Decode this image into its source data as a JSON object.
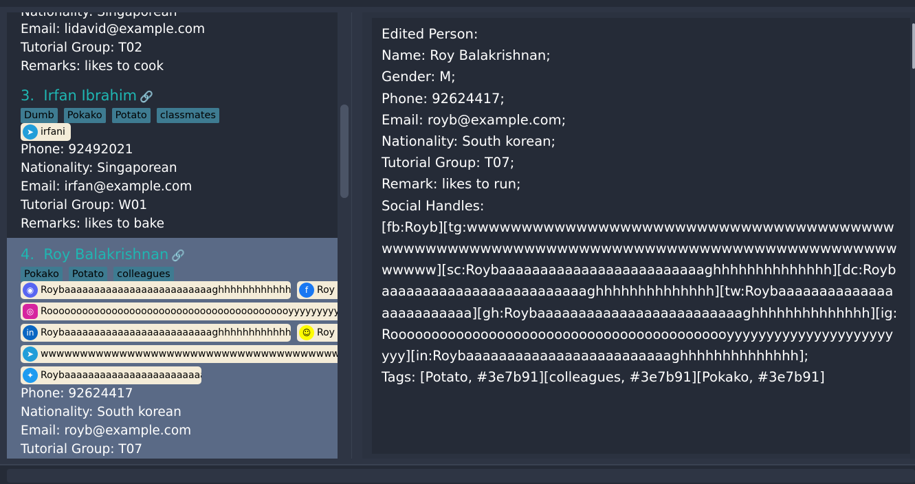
{
  "list": {
    "card2": {
      "nationality_partial": "Nationality: Singaporean",
      "email": "Email: lidavid@example.com",
      "tutorial": "Tutorial Group: T02",
      "remarks": "Remarks: likes to cook"
    },
    "card3": {
      "index": "3.",
      "name": "Irfan Ibrahim",
      "tags": [
        "Dumb",
        "Pokako",
        "Potato",
        "classmates"
      ],
      "telegram": "irfani",
      "phone": "Phone: 92492021",
      "nationality": "Nationality: Singaporean",
      "email": "Email: irfan@example.com",
      "tutorial": "Tutorial Group: W01",
      "remarks": "Remarks: likes to bake"
    },
    "card4": {
      "index": "4.",
      "name": "Roy Balakrishnan",
      "tags": [
        "Pokako",
        "Potato",
        "colleagues"
      ],
      "discord": "Roybaaaaaaaaaaaaaaaaaaaaaaaaaghhhhhhhhhhhhhh",
      "facebook": "Roy",
      "instagram": "Roooooooooooooooooooooooooooooooooooooooooyyyyyyyyyyyyyyyyyy",
      "linkedin": "Roybaaaaaaaaaaaaaaaaaaaaaaaaaghhhhhhhhhhhhhh",
      "snapchat": "Roy",
      "telegram": "wwwwwwwwwwwwwwwwwwwwwwwwwwwwwwwwwwwwwwwwwwwwwwwwwwwww",
      "twitter": "Roybaaaaaaaaaaaaaaaaaaaaaaaaa",
      "phone": "Phone: 92624417",
      "nationality": "Nationality: South korean",
      "email": "Email: royb@example.com",
      "tutorial": "Tutorial Group: T07"
    }
  },
  "result": {
    "lines": [
      "Edited Person:",
      "Name: Roy Balakrishnan;",
      "Gender: M;",
      "Phone: 92624417;",
      "Email: royb@example.com;",
      "Nationality: South korean;",
      "Tutorial Group: T07;",
      "Remark: likes to run;",
      "Social Handles:",
      "[fb:Royb][tg:wwwwwwwwwwwwwwwwwwwwwwwwwwwwwwwwwwwwwwwwwwwwwwwwwwwwwwwwwwwwwwwwwwwwwwwwwwwwwwwwwwwwwwwwwww][sc:Roybaaaaaaaaaaaaaaaaaaaaaaaaaghhhhhhhhhhhhhh][dc:Roybaaaaaaaaaaaaaaaaaaaaaaaaaghhhhhhhhhhhhhh][tw:Roybaaaaaaaaaaaaaaaaaaaaaaaaa][gh:Roybaaaaaaaaaaaaaaaaaaaaaaaaaghhhhhhhhhhhhhh][ig:Roooooooooooooooooooooooooooooooooooooooooyyyyyyyyyyyyyyyyyyyyyyyy][in:Roybaaaaaaaaaaaaaaaaaaaaaaaaaghhhhhhhhhhhhhh];",
      "Tags: [Potato, #3e7b91][colleagues, #3e7b91][Pokako, #3e7b91]"
    ]
  },
  "colors": {
    "tag": "#3e7b91",
    "name": "#1fb6b2",
    "selected": "#5a6a86"
  },
  "icons": [
    "link-icon",
    "telegram-icon",
    "discord-icon",
    "facebook-icon",
    "instagram-icon",
    "linkedin-icon",
    "snapchat-icon",
    "twitter-icon"
  ]
}
